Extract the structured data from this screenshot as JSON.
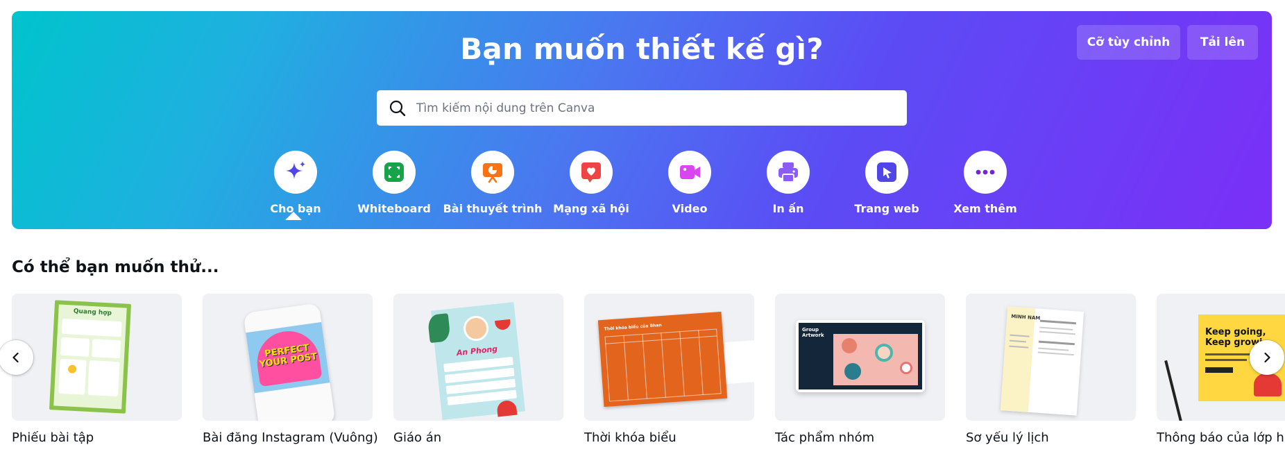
{
  "hero": {
    "title": "Bạn muốn thiết kế gì?",
    "custom_size_label": "Cỡ tùy chỉnh",
    "upload_label": "Tải lên",
    "search": {
      "placeholder": "Tìm kiếm nội dung trên Canva",
      "value": ""
    },
    "categories": [
      {
        "label": "Cho bạn",
        "icon": "sparkle-icon",
        "color": "#4f46e5",
        "selected": true
      },
      {
        "label": "Whiteboard",
        "icon": "whiteboard-icon",
        "color": "#16a34a"
      },
      {
        "label": "Bài thuyết trình",
        "icon": "presentation-icon",
        "color": "#f97316"
      },
      {
        "label": "Mạng xã hội",
        "icon": "heart-icon",
        "color": "#ef4444"
      },
      {
        "label": "Video",
        "icon": "video-camera-icon",
        "color": "#d946ef"
      },
      {
        "label": "In ấn",
        "icon": "printer-icon",
        "color": "#8b5cf6"
      },
      {
        "label": "Trang web",
        "icon": "web-cursor-icon",
        "color": "#4f46e5"
      },
      {
        "label": "Xem thêm",
        "icon": "more-dots-icon",
        "color": "#6d28d9"
      }
    ]
  },
  "suggestions": {
    "title": "Có thể bạn muốn thử...",
    "items": [
      {
        "label": "Phiếu bài tập",
        "thumb_text": "Quang hợp"
      },
      {
        "label": "Bài đăng Instagram (Vuông)",
        "thumb_text": "PERFECT YOUR POST"
      },
      {
        "label": "Giáo án",
        "thumb_text": "An Phong"
      },
      {
        "label": "Thời khóa biểu",
        "thumb_text": "Thời khóa biểu của Bhan"
      },
      {
        "label": "Tác phẩm nhóm",
        "thumb_text": "Group Artwork"
      },
      {
        "label": "Sơ yếu lý lịch",
        "thumb_text": "MINH NAM"
      },
      {
        "label": "Thông báo của lớp h",
        "thumb_text": "Keep going, Keep growi"
      }
    ]
  }
}
